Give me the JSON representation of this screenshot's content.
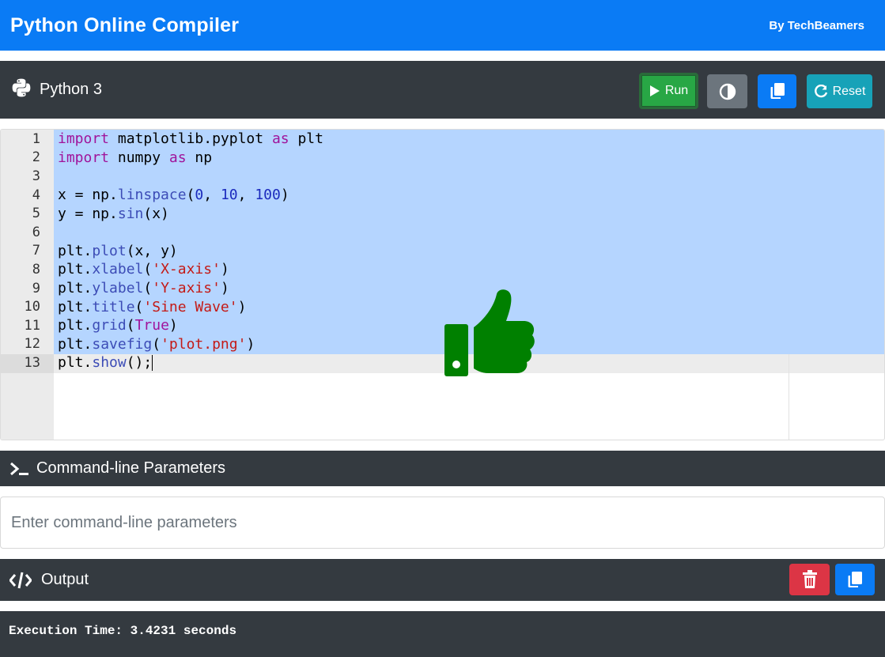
{
  "header": {
    "title": "Python Online Compiler",
    "byline": "By TechBeamers"
  },
  "language": {
    "name": "Python 3",
    "icon": "python-icon"
  },
  "toolbar": {
    "run_label": "Run",
    "reset_label": "Reset",
    "theme_icon": "contrast-icon",
    "copy_icon": "copy-icon"
  },
  "editor": {
    "lines": [
      "import matplotlib.pyplot as plt",
      "import numpy as np",
      "",
      "x = np.linspace(0, 10, 100)",
      "y = np.sin(x)",
      "",
      "plt.plot(x, y)",
      "plt.xlabel('X-axis')",
      "plt.ylabel('Y-axis')",
      "plt.title('Sine Wave')",
      "plt.grid(True)",
      "plt.savefig('plot.png')",
      "plt.show();"
    ],
    "line_numbers": [
      "1",
      "2",
      "3",
      "4",
      "5",
      "6",
      "7",
      "8",
      "9",
      "10",
      "11",
      "12",
      "13"
    ],
    "overlay_icon": "thumbs-up-icon"
  },
  "params": {
    "title": "Command-line Parameters",
    "placeholder": "Enter command-line parameters",
    "icon": "terminal-icon"
  },
  "output": {
    "title": "Output",
    "icon": "code-icon",
    "clear_icon": "trash-icon",
    "copy_icon": "copy-icon",
    "text": "Execution Time: 3.4231 seconds"
  },
  "colors": {
    "primary": "#0a7bf5",
    "dark": "#343a40",
    "success": "#28a745",
    "secondary": "#6c757d",
    "info": "#17a2b8",
    "danger": "#dc3545",
    "selection": "#b5d5ff",
    "thumb": "#008000"
  }
}
